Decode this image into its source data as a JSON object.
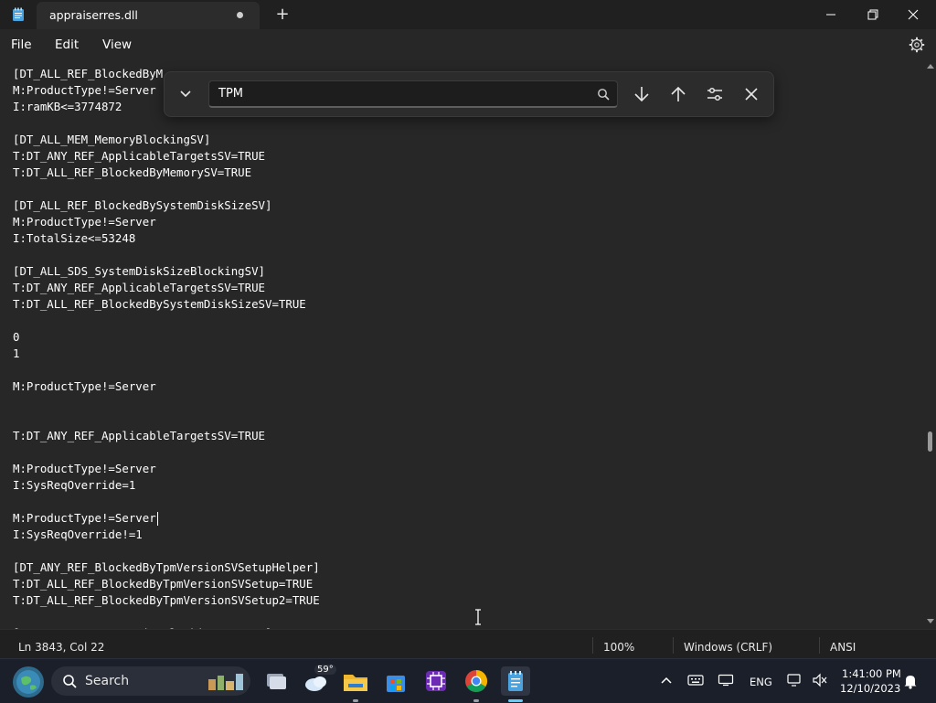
{
  "titlebar": {
    "tab_title": "appraiserres.dll",
    "new_tab_glyph": "+"
  },
  "menu": {
    "file": "File",
    "edit": "Edit",
    "view": "View"
  },
  "editor": {
    "lines": [
      "[DT_ALL_REF_BlockedByM",
      "M:ProductType!=Server",
      "I:ramKB<=3774872",
      "",
      "[DT_ALL_MEM_MemoryBlockingSV]",
      "T:DT_ANY_REF_ApplicableTargetsSV=TRUE",
      "T:DT_ALL_REF_BlockedByMemorySV=TRUE",
      "",
      "[DT_ALL_REF_BlockedBySystemDiskSizeSV]",
      "M:ProductType!=Server",
      "I:TotalSize<=53248",
      "",
      "[DT_ALL_SDS_SystemDiskSizeBlockingSV]",
      "T:DT_ANY_REF_ApplicableTargetsSV=TRUE",
      "T:DT_ALL_REF_BlockedBySystemDiskSizeSV=TRUE",
      "",
      "0",
      "1",
      "",
      "M:ProductType!=Server",
      "",
      "",
      "T:DT_ANY_REF_ApplicableTargetsSV=TRUE",
      "",
      "M:ProductType!=Server",
      "I:SysReqOverride=1",
      "",
      "M:ProductType!=Server",
      "I:SysReqOverride!=1",
      "",
      "[DT_ANY_REF_BlockedByTpmVersionSVSetupHelper]",
      "T:DT_ALL_REF_BlockedByTpmVersionSVSetup=TRUE",
      "T:DT_ALL_REF_BlockedByTpmVersionSVSetup2=TRUE",
      "",
      "[DT_ALL_TPM_TpmVersionBlockingSVSetup]"
    ]
  },
  "find": {
    "query": "TPM"
  },
  "status": {
    "position": "Ln 3843, Col 22",
    "zoom": "100%",
    "line_ending": "Windows (CRLF)",
    "encoding": "ANSI"
  },
  "taskbar": {
    "search_label": "Search",
    "temperature": "59°",
    "language": "ENG",
    "time": "1:41:00 PM",
    "date": "12/10/2023"
  },
  "icons": {
    "app": "notepad-icon",
    "minimize": "minimize-icon",
    "maximize": "restore-icon",
    "close": "close-icon",
    "settings": "gear-icon"
  },
  "colors": {
    "background": "#272727",
    "accent": "#60cdff"
  }
}
